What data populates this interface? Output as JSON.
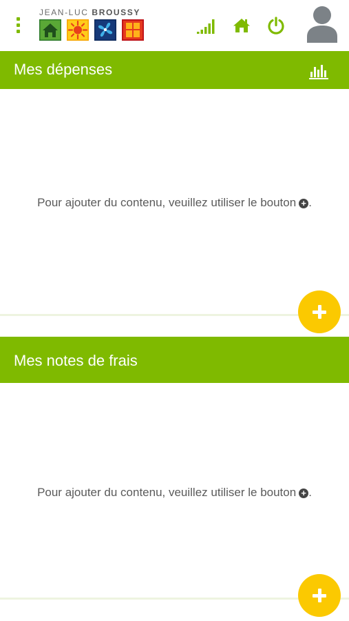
{
  "header": {
    "brand_prefix": "JEAN-LUC",
    "brand_name": "BROUSSY",
    "icons": [
      "menu-icon",
      "house-tile-icon",
      "sun-tile-icon",
      "fan-tile-icon",
      "window-tile-icon",
      "signal-icon",
      "home-icon",
      "power-icon",
      "user-avatar-icon"
    ],
    "accent_color": "#7fba00"
  },
  "sections": [
    {
      "title": "Mes dépenses",
      "empty_message": "Pour ajouter du contenu, veuillez utiliser le bouton",
      "message_end": "."
    },
    {
      "title": "Mes notes de frais",
      "empty_message": "Pour ajouter du contenu, veuillez utiliser le bouton",
      "message_end": "."
    }
  ],
  "fab_color": "#fbc901"
}
